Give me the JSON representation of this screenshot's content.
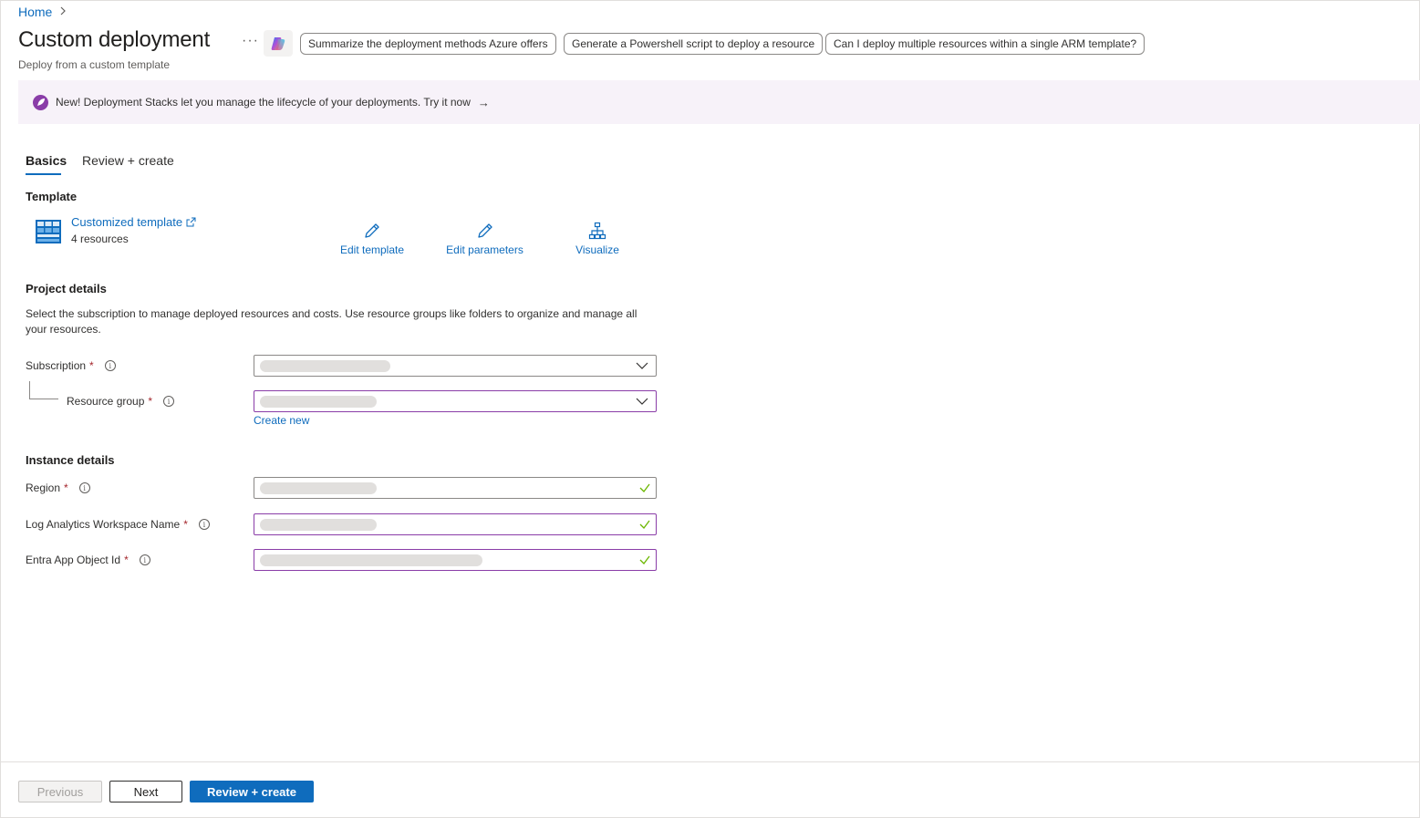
{
  "breadcrumb": {
    "home": "Home"
  },
  "header": {
    "title": "Custom deployment",
    "subtitle": "Deploy from a custom template",
    "more": "···"
  },
  "copilot_suggestions": [
    "Summarize the deployment methods Azure offers",
    "Generate a Powershell script to deploy a resource",
    "Can I deploy multiple resources within a single ARM template?"
  ],
  "banner": {
    "text": "New! Deployment Stacks let you manage the lifecycle of your deployments. Try it now",
    "arrow": "→"
  },
  "tabs": [
    {
      "label": "Basics",
      "active": true
    },
    {
      "label": "Review + create",
      "active": false
    }
  ],
  "template": {
    "heading": "Template",
    "name": "Customized template",
    "resources": "4 resources",
    "actions": {
      "edit_template": "Edit template",
      "edit_parameters": "Edit parameters",
      "visualize": "Visualize"
    }
  },
  "project": {
    "heading": "Project details",
    "description": "Select the subscription to manage deployed resources and costs. Use resource groups like folders to organize and manage all your resources.",
    "subscription_label": "Subscription",
    "resource_group_label": "Resource group",
    "create_new": "Create new",
    "required_mark": "*"
  },
  "instance": {
    "heading": "Instance details",
    "region_label": "Region",
    "workspace_label": "Log Analytics Workspace Name",
    "entra_label": "Entra App Object Id"
  },
  "footer": {
    "previous": "Previous",
    "next": "Next",
    "review_create": "Review + create"
  },
  "colors": {
    "accent": "#0f6cbd",
    "banner_bg": "#f7f2f9",
    "required": "#a4262c",
    "valid_check": "#6bb700",
    "focus_border": "#8a3da8"
  }
}
